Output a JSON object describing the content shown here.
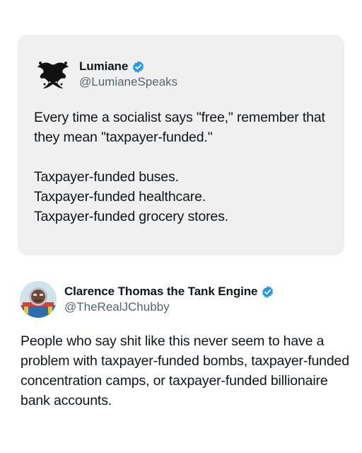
{
  "quoted_tweet": {
    "author": {
      "display_name": "Lumiane",
      "handle": "@LumianeSpeaks",
      "verified": true,
      "avatar_icon": "rorschach-inkblot-avatar"
    },
    "text": "Every time a socialist says \"free,\" remember that they mean \"taxpayer-funded.\"\n\nTaxpayer-funded buses.\nTaxpayer-funded healthcare.\nTaxpayer-funded grocery stores."
  },
  "reply_tweet": {
    "author": {
      "display_name": "Clarence Thomas the Tank Engine",
      "handle": "@TheRealJChubby",
      "verified": true,
      "avatar_icon": "tank-engine-face-avatar"
    },
    "text": "People who say shit like this never seem to have a problem with taxpayer-funded bombs, taxpayer-funded concentration camps, or taxpayer-funded billionaire bank accounts."
  },
  "colors": {
    "verified_blue": "#1d9bf0",
    "card_background": "#f0f0f0",
    "handle_gray": "#536471",
    "text_dark": "#0f1419"
  }
}
